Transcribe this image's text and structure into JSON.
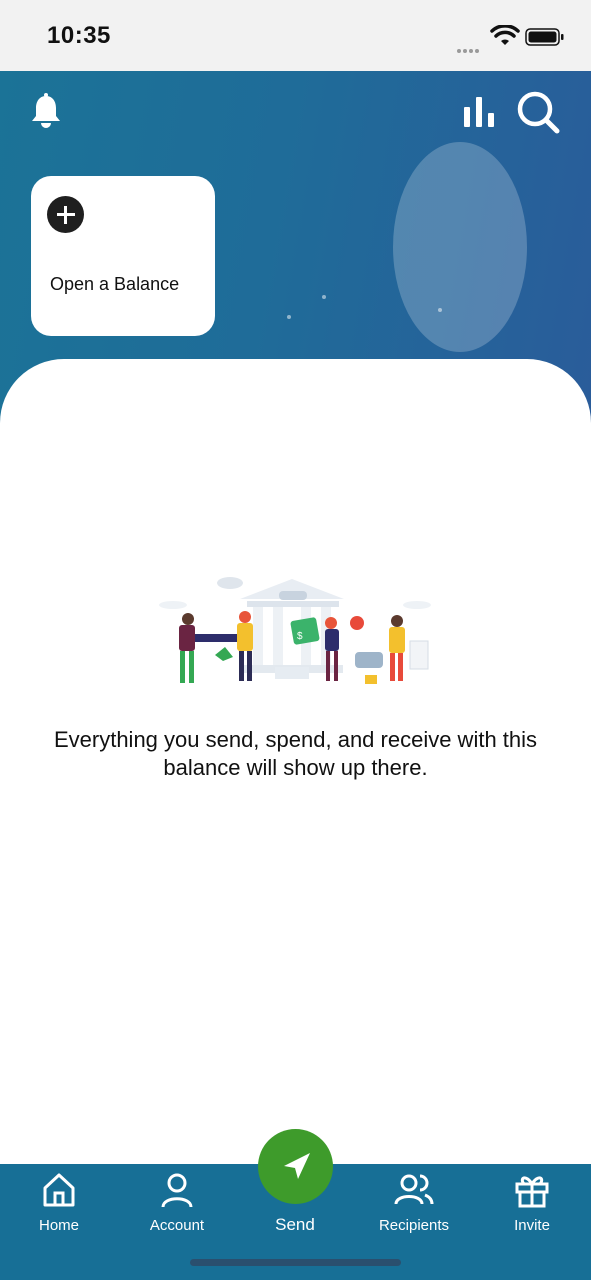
{
  "status_bar": {
    "time": "10:35"
  },
  "header": {
    "bell_icon": "bell-icon",
    "stats_icon": "bar-chart-icon",
    "search_icon": "search-icon"
  },
  "open_balance_card": {
    "icon": "plus-circle-icon",
    "label": "Open a Balance"
  },
  "empty_state": {
    "illustration": "bank-people-illustration",
    "message": "Everything you send, spend, and receive with this balance will show up there."
  },
  "bottom_nav": {
    "items": [
      {
        "label": "Home",
        "icon": "home-icon"
      },
      {
        "label": "Account",
        "icon": "person-icon"
      },
      {
        "label": "Send",
        "icon": "send-arrow-icon"
      },
      {
        "label": "Recipients",
        "icon": "people-icon"
      },
      {
        "label": "Invite",
        "icon": "gift-icon"
      }
    ]
  },
  "colors": {
    "header_gradient_start": "#1b7397",
    "header_gradient_end": "#2a5c9a",
    "nav_background": "#176f96",
    "send_button": "#3e9b2b"
  }
}
